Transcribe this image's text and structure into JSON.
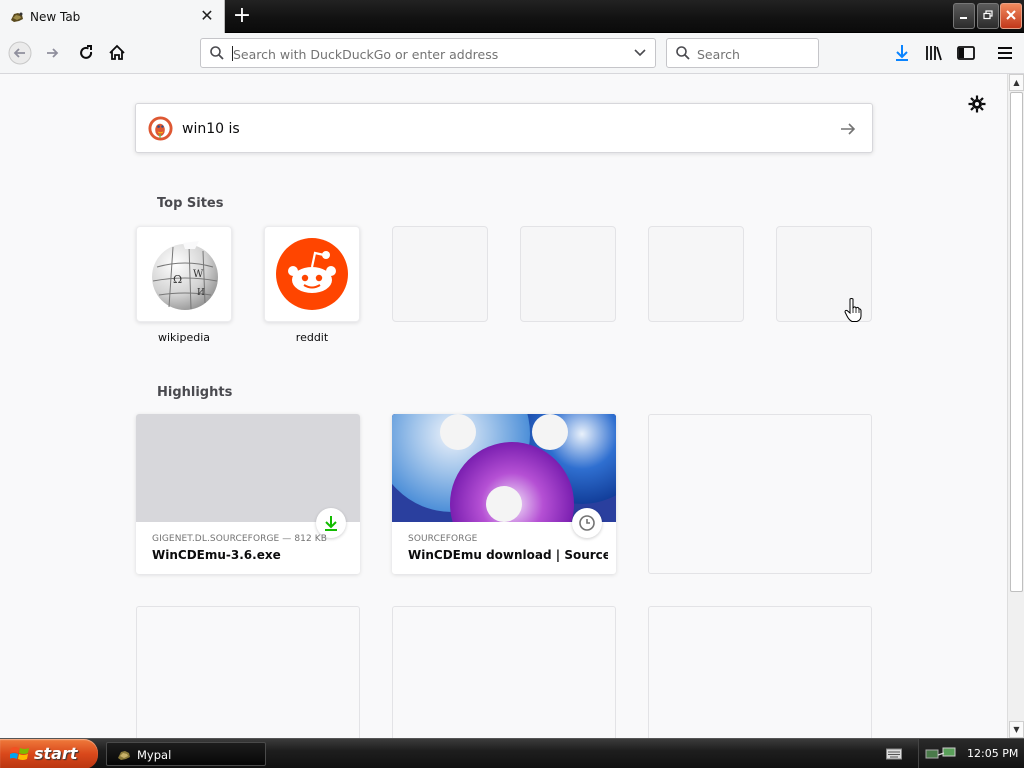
{
  "tab": {
    "title": "New Tab",
    "close": "✕"
  },
  "toolbar": {
    "url_placeholder": "Search with DuckDuckGo or enter address",
    "search_placeholder": "Search"
  },
  "search": {
    "query": "win10 is"
  },
  "top_sites": {
    "heading": "Top Sites",
    "sites": [
      {
        "label": "wikipedia"
      },
      {
        "label": "reddit"
      }
    ]
  },
  "highlights": {
    "heading": "Highlights",
    "cards": [
      {
        "context": "GIGENET.DL.SOURCEFORGE — 812 KB",
        "title": "WinCDEmu-3.6.exe",
        "badge": "download-icon"
      },
      {
        "context": "SOURCEFORGE",
        "title": "WinCDEmu download | SourceFo...",
        "badge": "clock-icon"
      }
    ]
  },
  "taskbar": {
    "start_label": "start",
    "app_label": "Mypal",
    "clock": "12:05 PM"
  },
  "colors": {
    "accent": "#0a84ff",
    "reddit": "#ff4500",
    "ddg": "#de5833",
    "start": "#d9481b"
  }
}
